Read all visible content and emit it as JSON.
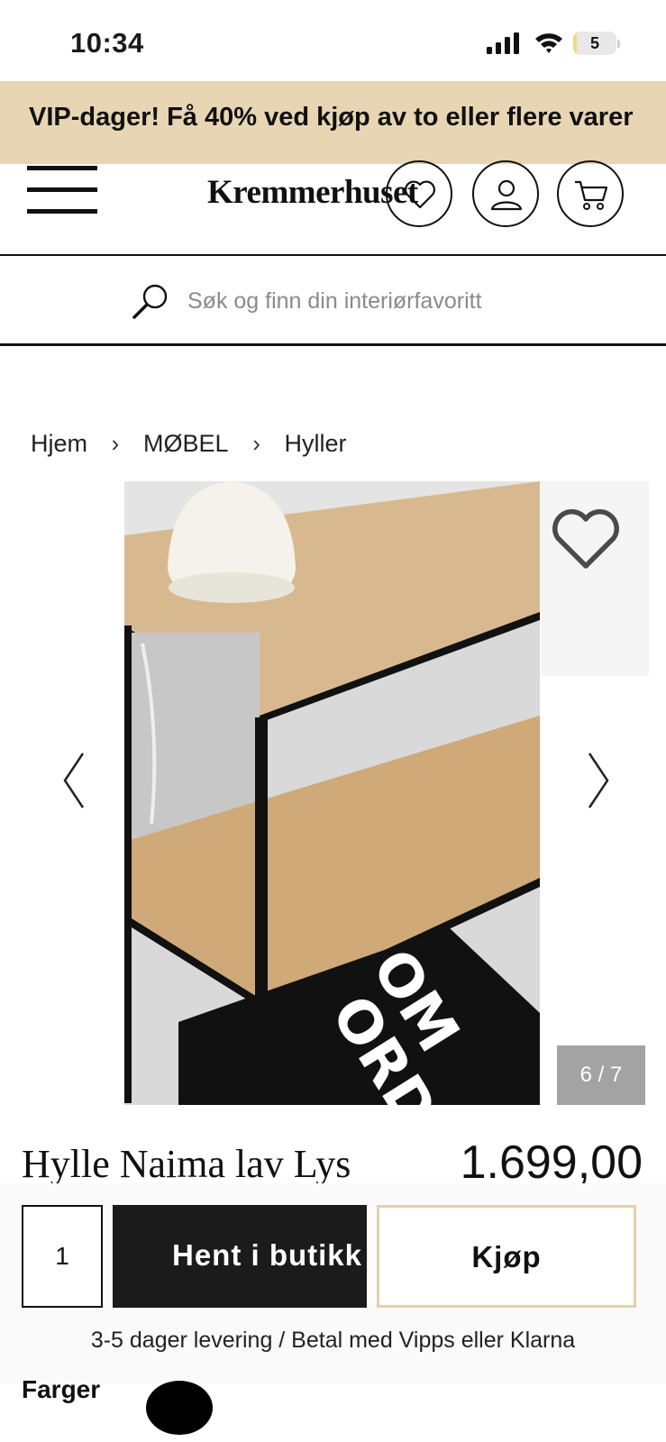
{
  "status_bar": {
    "time": "10:34",
    "battery_percent": "5",
    "battery_level": 0.05
  },
  "promo": {
    "text": "VIP-dager! Få 40% ved kjøp av to eller flere varer"
  },
  "header": {
    "logo": "Kremmerhuset"
  },
  "search": {
    "placeholder": "Søk og finn din interiørfavoritt"
  },
  "breadcrumb": {
    "items": [
      "Hjem",
      "MØBEL",
      "Hyller"
    ],
    "separator": "›"
  },
  "gallery": {
    "counter": "6 / 7",
    "book_title_line1": "OM",
    "book_title_line2": "ORD"
  },
  "product": {
    "title": "Hylle Naima lav Lys",
    "price": "1.699,00"
  },
  "buy_bar": {
    "quantity": "1",
    "pickup_label": "Hent i butikk",
    "buy_label": "Kjøp",
    "delivery_text": "3-5 dager levering / Betal med Vipps eller Klarna"
  },
  "colors": {
    "label": "Farger",
    "swatches": [
      "#000000"
    ]
  },
  "theme": {
    "accent": "#e8d5b3",
    "buy_border": "#e4d0ad",
    "dark": "#1b1b1b"
  }
}
